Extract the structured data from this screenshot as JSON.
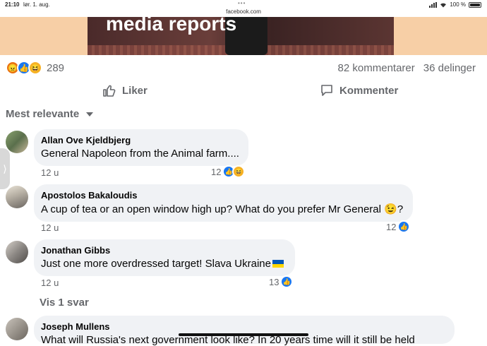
{
  "status_bar": {
    "time": "21:10",
    "date": "lør. 1. aug.",
    "url": "facebook.com",
    "battery": "100 %"
  },
  "post": {
    "banner_headline": "media reports",
    "reaction_count": "289",
    "comments_count": "82 kommentarer",
    "shares_count": "36 delinger",
    "like_label": "Liker",
    "comment_label": "Kommenter",
    "sort_label": "Mest relevante"
  },
  "comments": [
    {
      "author": "Allan Ove Kjeldbjerg",
      "text": "General Napoleon from the Animal farm....",
      "age": "12 u",
      "reactions": "12"
    },
    {
      "author": "Apostolos Bakaloudis",
      "text": "A cup of tea or an open window high up? What do you prefer Mr General",
      "emoji": "😉",
      "suffix": "?",
      "age": "12 u",
      "reactions": "12"
    },
    {
      "author": "Jonathan Gibbs",
      "text": "Just one more overdressed target! Slava Ukraine",
      "age": "12 u",
      "reactions": "13"
    },
    {
      "author": "Joseph Mullens",
      "text": "What will Russia's next government look like? In 20 years time will it still be held"
    }
  ],
  "replies": {
    "label": "Vis 1 svar"
  },
  "colors": {
    "accent": "#1877f2",
    "bubble": "#f0f2f5",
    "muted": "#65676b",
    "banner": "#f7cfa6"
  }
}
